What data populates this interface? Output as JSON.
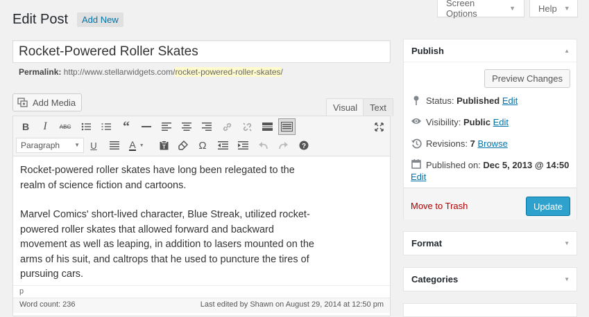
{
  "header": {
    "title": "Edit Post",
    "add_new": "Add New",
    "screen_options": "Screen Options",
    "help": "Help"
  },
  "post": {
    "title": "Rocket-Powered Roller Skates",
    "permalink_label": "Permalink:",
    "permalink_base": "http://www.stellarwidgets.com/",
    "permalink_slug": "rocket-powered-roller-skates",
    "permalink_end": "/"
  },
  "editor": {
    "add_media": "Add Media",
    "tab_visual": "Visual",
    "tab_text": "Text",
    "format_select": "Paragraph",
    "toolbar_row1": [
      "bold-icon",
      "italic-icon",
      "strikethrough-icon",
      "bullet-list-icon",
      "numbered-list-icon",
      "blockquote-icon",
      "horizontal-rule-icon",
      "align-left-icon",
      "align-center-icon",
      "align-right-icon",
      "link-icon",
      "unlink-icon",
      "read-more-icon",
      "toolbar-toggle-icon",
      "fullscreen-icon"
    ],
    "toolbar_row2": [
      "underline-icon",
      "justify-icon",
      "text-color-icon",
      "paste-text-icon",
      "clear-formatting-icon",
      "special-character-icon",
      "outdent-icon",
      "indent-icon",
      "undo-icon",
      "redo-icon",
      "help-icon"
    ],
    "paragraphs": [
      "Rocket-powered roller skates have long been relegated to the realm of science fiction and cartoons.",
      "Marvel Comics' short-lived character, Blue Streak, utilized rocket-powered roller skates that allowed forward and backward movement as well as leaping, in addition to lasers mounted on the arms of his suit, and caltrops that he used to puncture the tires of pursuing cars."
    ],
    "path": "p",
    "word_count": "Word count: 236",
    "last_edited": "Last edited by Shawn on August 29, 2014 at 12:50 pm"
  },
  "publish": {
    "title": "Publish",
    "preview": "Preview Changes",
    "status_label": "Status:",
    "status_value": "Published",
    "visibility_label": "Visibility:",
    "visibility_value": "Public",
    "revisions_label": "Revisions:",
    "revisions_value": "7",
    "browse": "Browse",
    "published_label": "Published on:",
    "published_value": "Dec 5, 2013 @ 14:50",
    "edit": "Edit",
    "trash": "Move to Trash",
    "update": "Update"
  },
  "boxes": {
    "format": "Format",
    "categories": "Categories"
  },
  "colors": {
    "accent": "#2ea2cc",
    "link": "#0073aa",
    "trash": "#aa0000"
  }
}
